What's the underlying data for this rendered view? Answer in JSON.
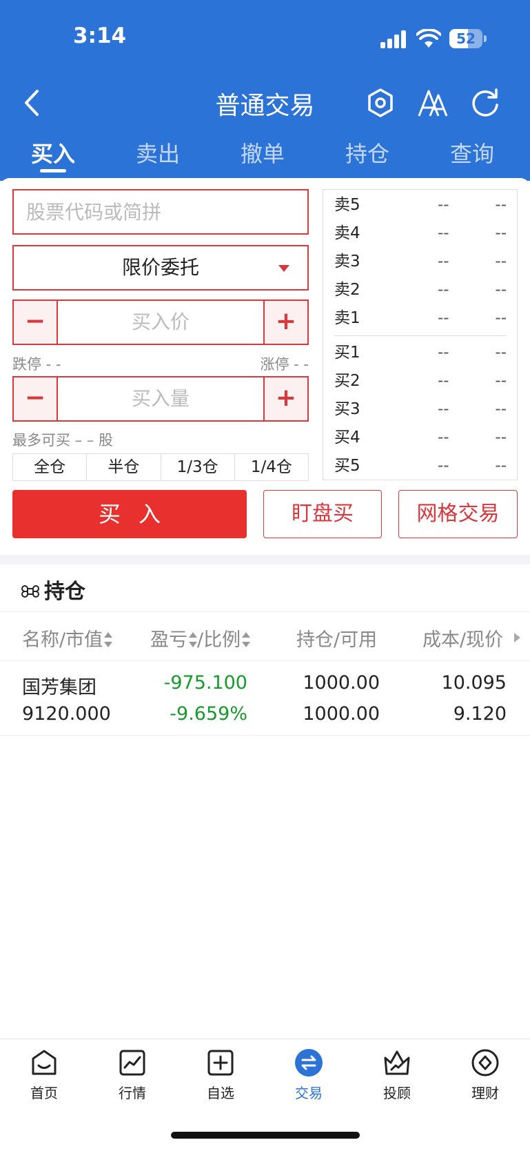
{
  "status": {
    "time": "3:14",
    "battery": "52"
  },
  "nav": {
    "title": "普通交易"
  },
  "tabs": [
    "买入",
    "卖出",
    "撤单",
    "持仓",
    "查询"
  ],
  "form": {
    "search_placeholder": "股票代码或简拼",
    "order_type": "限价委托",
    "price_placeholder": "买入价",
    "qty_placeholder": "买入量",
    "minus": "−",
    "plus": "+",
    "limit_down": "跌停 - -",
    "limit_up": "涨停 - -",
    "max_buy": "最多可买 – – 股",
    "ratios": [
      "全仓",
      "半仓",
      "1/3仓",
      "1/4仓"
    ]
  },
  "book": {
    "rows": [
      {
        "label": "卖5",
        "price": "--",
        "vol": "--"
      },
      {
        "label": "卖4",
        "price": "--",
        "vol": "--"
      },
      {
        "label": "卖3",
        "price": "--",
        "vol": "--"
      },
      {
        "label": "卖2",
        "price": "--",
        "vol": "--"
      },
      {
        "label": "卖1",
        "price": "--",
        "vol": "--"
      },
      {
        "label": "买1",
        "price": "--",
        "vol": "--"
      },
      {
        "label": "买2",
        "price": "--",
        "vol": "--"
      },
      {
        "label": "买3",
        "price": "--",
        "vol": "--"
      },
      {
        "label": "买4",
        "price": "--",
        "vol": "--"
      },
      {
        "label": "买5",
        "price": "--",
        "vol": "--"
      }
    ]
  },
  "actions": {
    "buy": "买入",
    "watch_buy": "盯盘买",
    "grid": "网格交易"
  },
  "positions": {
    "title": "持仓",
    "headers": {
      "name": "名称/市值",
      "pl_a": "盈亏",
      "pl_b": "/比例",
      "hold": "持仓/可用",
      "cost": "成本/现价"
    },
    "rows": [
      {
        "name": "国芳集团",
        "value": "9120.000",
        "pl": "-975.100",
        "ratio": "-9.659%",
        "hold": "1000.00",
        "avail": "1000.00",
        "cost": "10.095",
        "price": "9.120"
      }
    ]
  },
  "bottom_nav": [
    "首页",
    "行情",
    "自选",
    "交易",
    "投顾",
    "理财"
  ],
  "colors": {
    "brand": "#2B73D6",
    "buy_red": "#E8302E",
    "loss_green": "#179A2C"
  }
}
